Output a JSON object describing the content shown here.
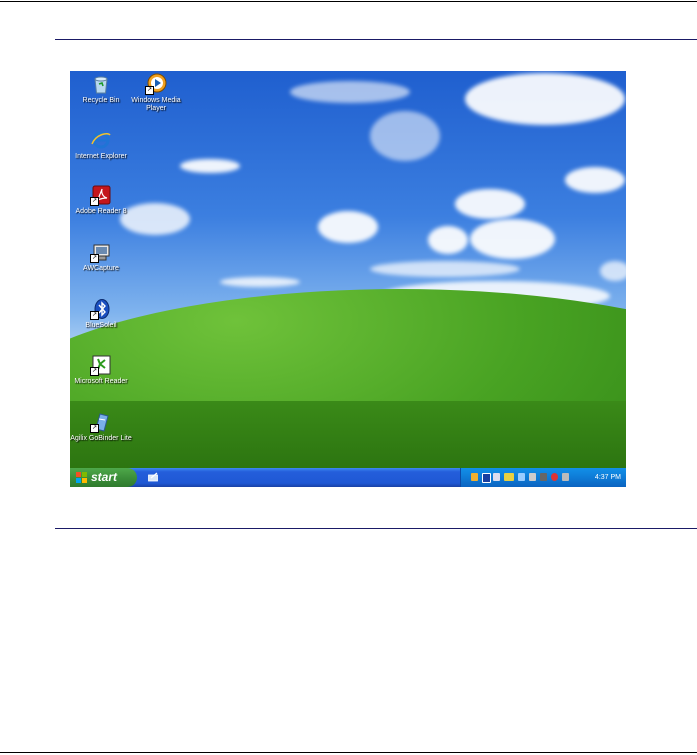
{
  "desktop": {
    "icons": [
      {
        "label": "Recycle Bin",
        "icon": "recycle-bin-icon"
      },
      {
        "label": "Windows Media Player",
        "icon": "media-player-icon"
      },
      {
        "label": "Internet Explorer",
        "icon": "internet-explorer-icon"
      },
      {
        "label": "Adobe Reader 8",
        "icon": "adobe-reader-icon"
      },
      {
        "label": "AWCapture",
        "icon": "capture-icon"
      },
      {
        "label": "BlueSoleil",
        "icon": "bluetooth-icon"
      },
      {
        "label": "Microsoft Reader",
        "icon": "microsoft-reader-icon"
      },
      {
        "label": "Agilix GoBinder Lite",
        "icon": "gobinder-icon"
      }
    ]
  },
  "taskbar": {
    "start_label": "start",
    "clock": "4:37 PM"
  },
  "colors": {
    "taskbar": "#245edb",
    "start_button": "#3c8f3a",
    "tray": "#0e7bd6"
  }
}
